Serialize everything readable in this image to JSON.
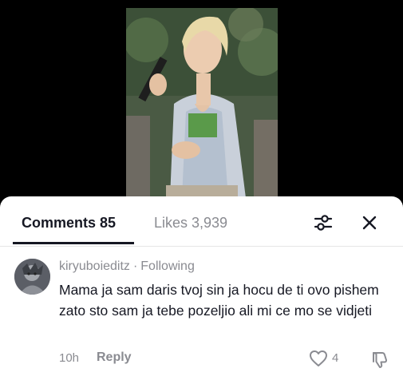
{
  "video": {
    "description_icon": "video-thumbnail"
  },
  "tabs": {
    "comments_label": "Comments 85",
    "likes_label": "Likes 3,939"
  },
  "header_icons": {
    "filter_icon": "filter-sliders-icon",
    "close_icon": "close-icon"
  },
  "comment": {
    "username": "kiryuboieditz",
    "separator": "·",
    "relation": "Following",
    "text": "Mama ja sam daris tvoj sin ja hocu de ti ovo pishem zato sto sam ja tebe pozeljio ali mi ce mo se vidjeti",
    "time": "10h",
    "reply_label": "Reply",
    "like_count": "4",
    "like_icon": "heart-icon",
    "dislike_icon": "thumbs-down-icon"
  },
  "colors": {
    "text_primary": "#161823",
    "text_secondary": "#8a8b91",
    "background": "#ffffff",
    "video_bg": "#000000"
  }
}
